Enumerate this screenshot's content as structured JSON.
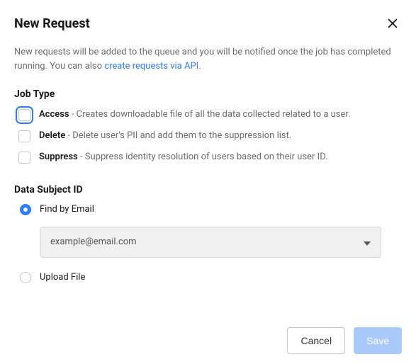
{
  "header": {
    "title": "New Request"
  },
  "description": {
    "text_before": "New requests will be added to the queue and you will be notified once the job has completed running. You can also ",
    "link_text": "create requests via API",
    "text_after": "."
  },
  "job_type": {
    "label": "Job Type",
    "options": [
      {
        "name": "Access",
        "desc": " - Creates downloadable file of all the data collected related to a user."
      },
      {
        "name": "Delete",
        "desc": " - Delete user's PII and add them to the suppression list."
      },
      {
        "name": "Suppress",
        "desc": " - Suppress identity resolution of users based on their user ID."
      }
    ]
  },
  "data_subject": {
    "label": "Data Subject ID",
    "find_by_email_label": "Find by Email",
    "email_placeholder": "example@email.com",
    "upload_file_label": "Upload File"
  },
  "footer": {
    "cancel": "Cancel",
    "save": "Save"
  }
}
